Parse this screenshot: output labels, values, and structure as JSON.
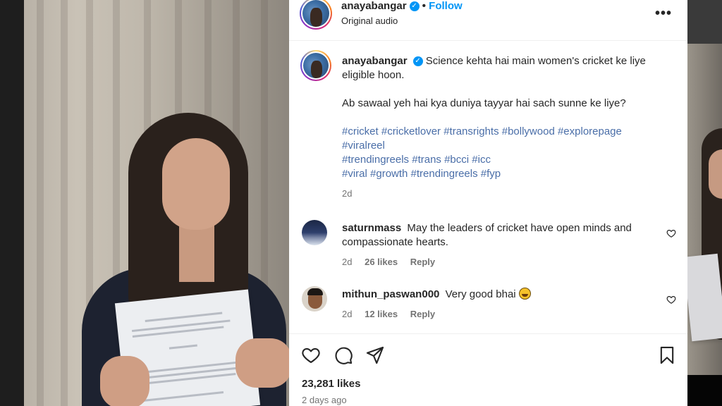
{
  "header": {
    "username": "anayabangar",
    "separator": "•",
    "follow_label": "Follow",
    "audio": "Original audio",
    "more": "•••"
  },
  "caption": {
    "username": "anayabangar",
    "line1": "Science kehta hai main women's cricket ke liye eligible hoon.",
    "line2": "Ab sawaal yeh hai kya duniya tayyar hai sach sunne ke liye?",
    "hashtags_line1": "#cricket #cricketlover #transrights #bollywood #explorepage",
    "hashtags_line2": "#viralreel",
    "hashtags_line3": "#trendingreels #trans #bcci #icc",
    "hashtags_line4": "#viral #growth #trendingreels #fyp",
    "time": "2d"
  },
  "comments": [
    {
      "username": "saturnmass",
      "text": "May the leaders of cricket have open minds and compassionate hearts.",
      "time": "2d",
      "likes": "26 likes",
      "reply": "Reply"
    },
    {
      "username": "mithun_paswan000",
      "text": "Very good bhai",
      "time": "2d",
      "likes": "12 likes",
      "reply": "Reply"
    }
  ],
  "post": {
    "likes": "23,281 likes",
    "time": "2 days ago"
  },
  "icons": {
    "like": "heart-icon",
    "comment": "comment-icon",
    "share": "share-icon",
    "save": "bookmark-icon",
    "verified": "verified-badge-icon",
    "emoji": "grinning-face-emoji"
  },
  "colors": {
    "link_blue": "#0095f6",
    "hashtag": "#4a6ea8",
    "muted": "#737373",
    "text": "#262626"
  }
}
